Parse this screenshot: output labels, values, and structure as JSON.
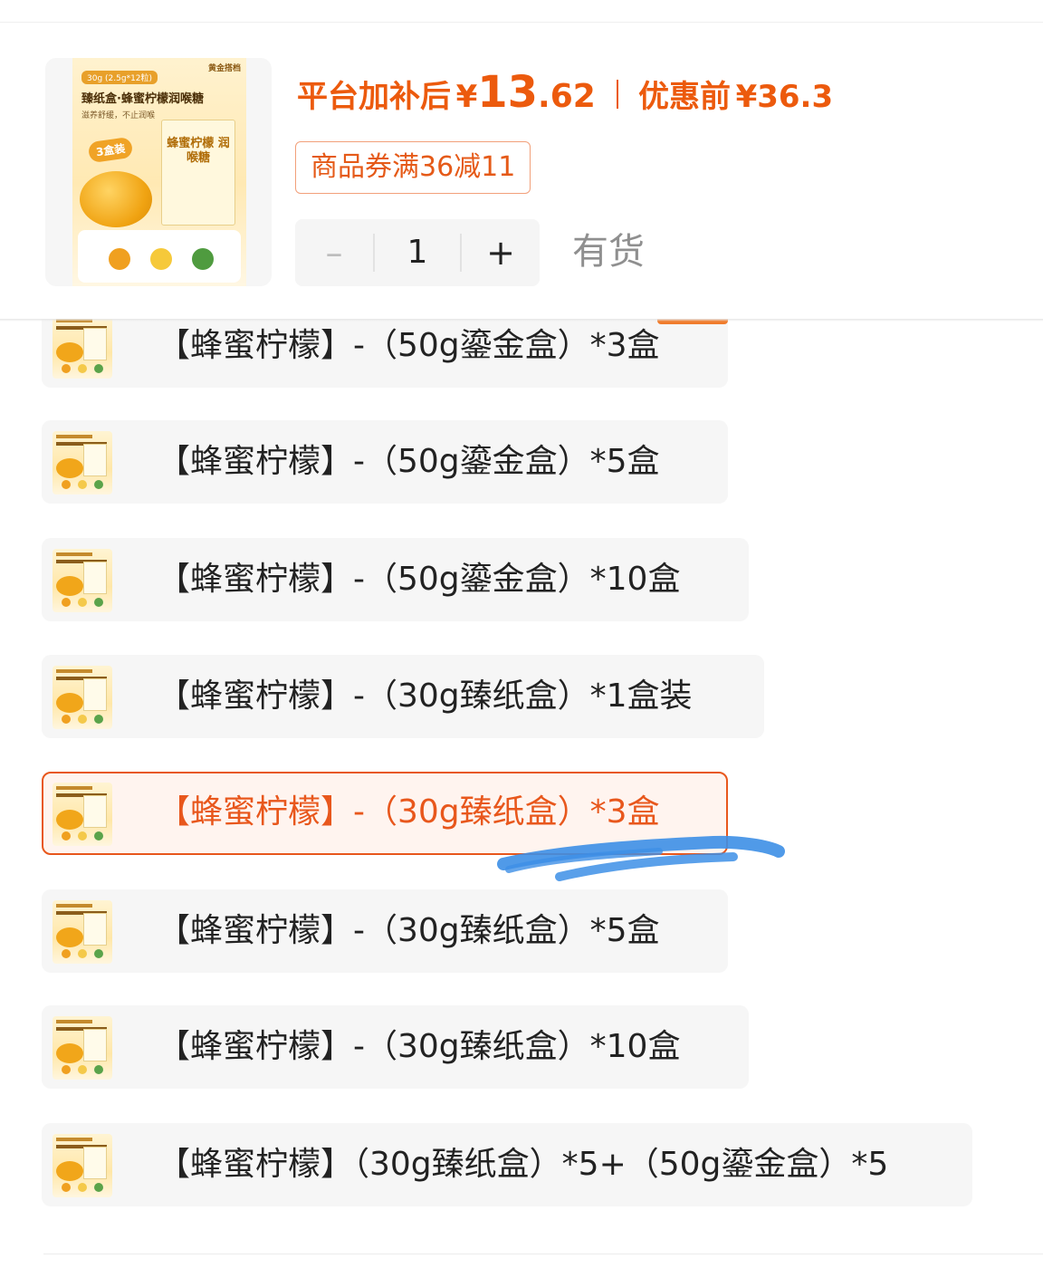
{
  "product": {
    "image_alt": "蜂蜜柠檬润喉糖 product image",
    "image_text": {
      "brand": "黄金搭档",
      "badge": "30g (2.5g*12粒)",
      "title": "臻纸盒·蜂蜜柠檬润喉糖",
      "subtitle": "滋养舒缓，不止润喉",
      "tag": "3盒装",
      "box_text": "蜂蜜柠檬 润喉糖"
    }
  },
  "price": {
    "after_label": "平台加补后",
    "currency": "¥",
    "after_int": "13",
    "after_dec": ".62",
    "before_label": "优惠前",
    "before_value": "36.3"
  },
  "coupon": {
    "label": "商品券满36减11"
  },
  "quantity": {
    "minus": "–",
    "value": "1",
    "plus": "+"
  },
  "stock": {
    "label": "有货"
  },
  "variants": [
    {
      "label": "【蜂蜜柠檬】-（50g鎏金盒）*3盒",
      "selected": false
    },
    {
      "label": "【蜂蜜柠檬】-（50g鎏金盒）*5盒",
      "selected": false
    },
    {
      "label": "【蜂蜜柠檬】-（50g鎏金盒）*10盒",
      "selected": false
    },
    {
      "label": "【蜂蜜柠檬】-（30g臻纸盒）*1盒装",
      "selected": false
    },
    {
      "label": "【蜂蜜柠檬】-（30g臻纸盒）*3盒",
      "selected": true
    },
    {
      "label": "【蜂蜜柠檬】-（30g臻纸盒）*5盒",
      "selected": false
    },
    {
      "label": "【蜂蜜柠檬】-（30g臻纸盒）*10盒",
      "selected": false
    },
    {
      "label": "【蜂蜜柠檬】（30g臻纸盒）*5+（50g鎏金盒）*5",
      "selected": false
    }
  ],
  "colors": {
    "accent": "#E8571C",
    "price": "#EC5A0D",
    "stock_text": "#8F8F8F",
    "annotation_scribble": "#3D8FE6"
  }
}
